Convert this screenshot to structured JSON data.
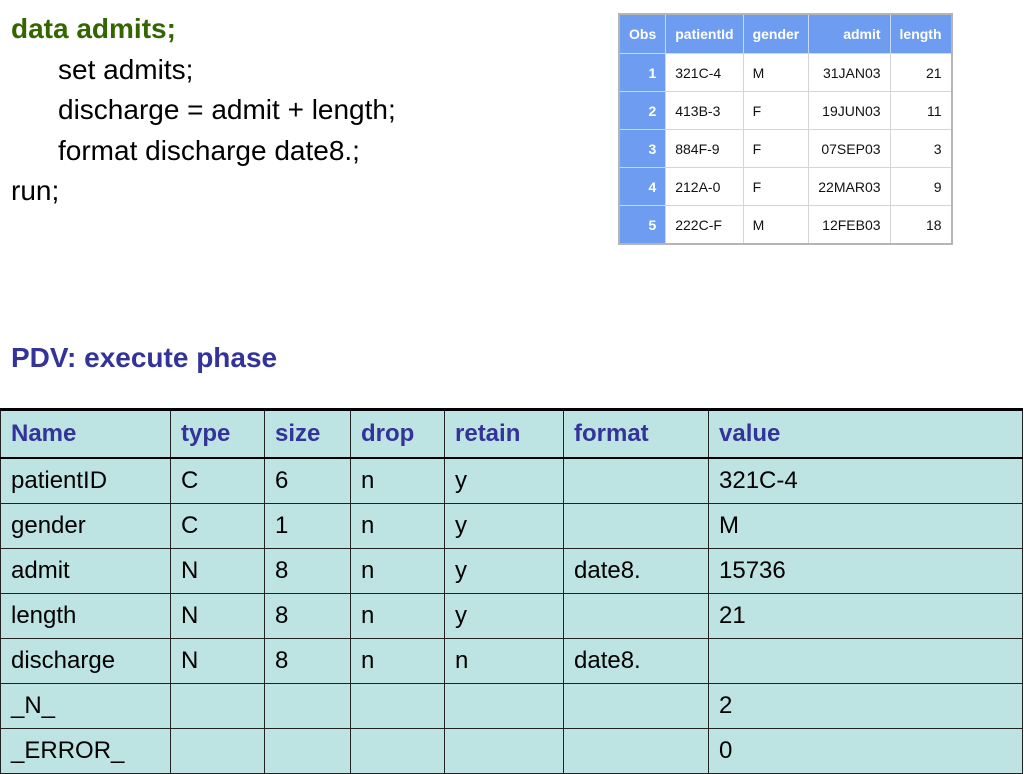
{
  "code": {
    "line1": "data admits;",
    "line2": "set admits;",
    "line3": "discharge = admit + length;",
    "line4": "format discharge date8.;",
    "line5": "run;"
  },
  "admits_table": {
    "headers": [
      "Obs",
      "patientId",
      "gender",
      "admit",
      "length"
    ],
    "rows": [
      [
        "1",
        "321C-4",
        "M",
        "31JAN03",
        "21"
      ],
      [
        "2",
        "413B-3",
        "F",
        "19JUN03",
        "11"
      ],
      [
        "3",
        "884F-9",
        "F",
        "07SEP03",
        "3"
      ],
      [
        "4",
        "212A-0",
        "F",
        "22MAR03",
        "9"
      ],
      [
        "5",
        "222C-F",
        "M",
        "12FEB03",
        "18"
      ]
    ]
  },
  "pdv": {
    "title": "PDV: execute phase",
    "headers": [
      "Name",
      "type",
      "size",
      "drop",
      "retain",
      "format",
      "value"
    ],
    "rows": [
      [
        "patientID",
        "C",
        "6",
        "n",
        "y",
        "",
        "321C-4"
      ],
      [
        "gender",
        "C",
        "1",
        "n",
        "y",
        "",
        "M"
      ],
      [
        "admit",
        "N",
        "8",
        "n",
        "y",
        "date8.",
        "15736"
      ],
      [
        "length",
        "N",
        "8",
        "n",
        "y",
        "",
        "21"
      ],
      [
        "discharge",
        "N",
        "8",
        "n",
        "n",
        "date8.",
        ""
      ],
      [
        "_N_",
        "",
        "",
        "",
        "",
        "",
        "2"
      ],
      [
        "_ERROR_",
        "",
        "",
        "",
        "",
        "",
        "0"
      ]
    ]
  },
  "colors": {
    "keyword": "#336600",
    "pdv_title": "#333399",
    "obs_header": "#6e9cf0",
    "pdv_background": "#bde3e3"
  }
}
